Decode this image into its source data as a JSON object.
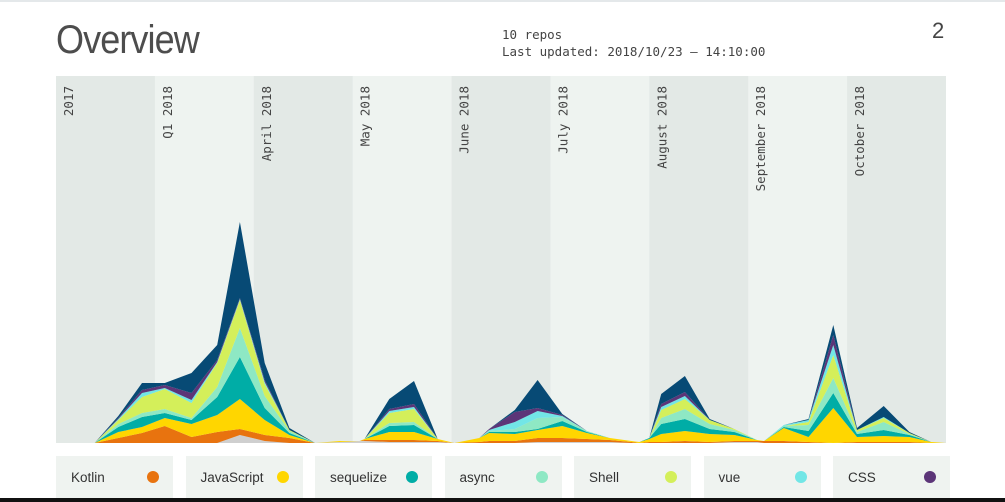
{
  "header": {
    "title": "Overview",
    "repos": "10 repos",
    "last_updated": "Last updated: 2018/10/23 – 14:10:00",
    "page": "2"
  },
  "chart_data": {
    "type": "area",
    "stacked": true,
    "bands": [
      "2017",
      "Q1 2018",
      "April 2018",
      "May 2018",
      "June 2018",
      "July 2018",
      "August 2018",
      "September 2018",
      "October 2018"
    ],
    "x": [
      0.39,
      0.63,
      0.87,
      1.1,
      1.37,
      1.63,
      1.86,
      2.11,
      2.36,
      2.62,
      2.87,
      3.07,
      3.12,
      3.37,
      3.62,
      3.86,
      4.03,
      4.28,
      4.38,
      4.64,
      4.87,
      5.12,
      5.37,
      5.6,
      5.82,
      5.9,
      6.0,
      6.12,
      6.36,
      6.61,
      6.86,
      7.09,
      7.16,
      7.36,
      7.61,
      7.86,
      8.1,
      8.37,
      8.63,
      8.85,
      9.0
    ],
    "series": [
      {
        "key": "other-gray",
        "color": "#cfcfcf",
        "values": [
          0,
          0,
          0,
          0,
          0,
          0,
          8,
          2,
          0,
          0,
          1,
          2,
          2,
          1,
          1,
          1,
          0,
          0,
          0,
          0,
          1,
          1,
          1,
          1,
          0,
          0,
          0,
          0,
          0,
          0,
          1,
          1,
          0,
          0,
          0,
          0,
          0,
          0,
          0,
          0,
          0
        ]
      },
      {
        "name": "Kotlin",
        "color": "#e8730f",
        "values": [
          0,
          5,
          10,
          17,
          6,
          11,
          6,
          6,
          5,
          0,
          0,
          0,
          1,
          2,
          2,
          1,
          0,
          1,
          2,
          2,
          4,
          4,
          3,
          2,
          1,
          0,
          1,
          1,
          2,
          1,
          1,
          1,
          2,
          2,
          1,
          0,
          1,
          1,
          1,
          0,
          0
        ]
      },
      {
        "name": "JavaScript",
        "color": "#ffd600",
        "values": [
          0,
          6,
          6,
          8,
          13,
          17,
          30,
          15,
          3,
          0,
          1,
          0,
          1,
          8,
          8,
          2,
          0,
          4,
          8,
          7,
          8,
          12,
          6,
          2,
          1,
          1,
          3,
          8,
          10,
          8,
          6,
          1,
          0,
          13,
          5,
          35,
          5,
          6,
          5,
          1,
          0
        ]
      },
      {
        "name": "sequelize",
        "color": "#00ada6",
        "values": [
          0,
          5,
          10,
          5,
          4,
          18,
          42,
          12,
          2,
          0,
          0,
          0,
          0,
          6,
          7,
          0,
          0,
          0,
          1,
          2,
          1,
          5,
          1,
          0,
          0,
          0,
          1,
          10,
          12,
          5,
          3,
          0,
          0,
          1,
          6,
          15,
          3,
          6,
          2,
          0,
          0
        ]
      },
      {
        "name": "async",
        "color": "#8ee8c4",
        "values": [
          0,
          3,
          4,
          4,
          2,
          10,
          29,
          12,
          2,
          0,
          0,
          0,
          0,
          3,
          3,
          0,
          0,
          0,
          1,
          3,
          11,
          4,
          1,
          0,
          0,
          0,
          0,
          6,
          10,
          5,
          2,
          0,
          0,
          1,
          6,
          15,
          2,
          8,
          1,
          0,
          0
        ]
      },
      {
        "name": "Shell",
        "color": "#d4ef5a",
        "values": [
          0,
          4,
          16,
          20,
          15,
          24,
          28,
          12,
          1,
          0,
          0,
          0,
          0,
          10,
          13,
          0,
          0,
          0,
          0,
          0,
          0,
          0,
          0,
          0,
          0,
          0,
          0,
          8,
          10,
          4,
          1,
          0,
          0,
          0,
          3,
          23,
          2,
          4,
          1,
          0,
          0
        ]
      },
      {
        "name": "vue",
        "color": "#72e6e6",
        "values": [
          0,
          1,
          4,
          1,
          3,
          1,
          1,
          2,
          0,
          0,
          0,
          0,
          0,
          2,
          2,
          0,
          0,
          0,
          1,
          7,
          7,
          1,
          0,
          0,
          0,
          0,
          0,
          3,
          3,
          0,
          0,
          0,
          0,
          1,
          2,
          10,
          0,
          1,
          0,
          0,
          0
        ]
      },
      {
        "name": "CSS",
        "color": "#5c3578",
        "values": [
          0,
          1,
          3,
          3,
          7,
          2,
          1,
          2,
          0,
          0,
          0,
          0,
          0,
          2,
          3,
          0,
          0,
          0,
          1,
          10,
          3,
          1,
          0,
          0,
          0,
          0,
          0,
          3,
          4,
          0,
          0,
          0,
          0,
          0,
          0,
          10,
          0,
          0,
          0,
          0,
          0
        ]
      },
      {
        "key": "other-navy",
        "color": "#074a75",
        "values": [
          0,
          2,
          7,
          2,
          20,
          15,
          76,
          17,
          2,
          0,
          0,
          0,
          0,
          10,
          23,
          0,
          0,
          0,
          0,
          2,
          28,
          1,
          0,
          0,
          0,
          0,
          0,
          10,
          16,
          1,
          0,
          0,
          0,
          0,
          1,
          10,
          2,
          11,
          1,
          0,
          0
        ]
      }
    ],
    "band_colors": [
      "#e3e9e6",
      "#eef3f0"
    ],
    "legend": [
      {
        "label": "Kotlin",
        "color": "#e8730f"
      },
      {
        "label": "JavaScript",
        "color": "#ffd600"
      },
      {
        "label": "sequelize",
        "color": "#00ada6"
      },
      {
        "label": "async",
        "color": "#8ee8c4"
      },
      {
        "label": "Shell",
        "color": "#d4ef5a"
      },
      {
        "label": "vue",
        "color": "#72e6e6"
      },
      {
        "label": "CSS",
        "color": "#5c3578"
      }
    ],
    "legend_placement": "bottom"
  }
}
